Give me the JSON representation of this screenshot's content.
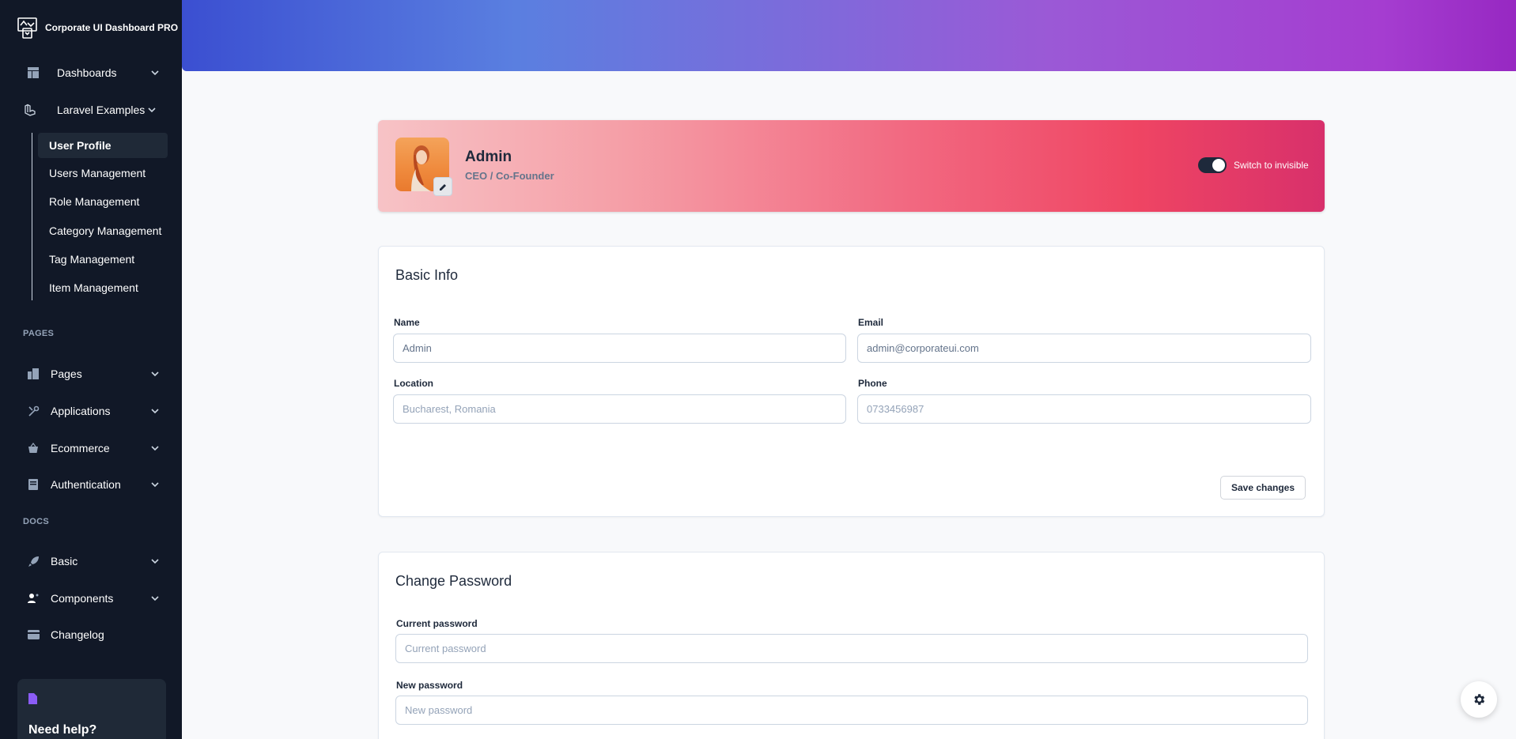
{
  "brand": {
    "title": "Corporate UI Dashboard PRO"
  },
  "sidebar": {
    "top_items": [
      {
        "label": "Dashboards",
        "icon": "dashboard-icon"
      },
      {
        "label": "Laravel Examples",
        "icon": "laravel-icon"
      }
    ],
    "sub_items": [
      {
        "label": "User Profile",
        "active": true
      },
      {
        "label": "Users Management"
      },
      {
        "label": "Role Management"
      },
      {
        "label": "Category Management"
      },
      {
        "label": "Tag Management"
      },
      {
        "label": "Item Management"
      }
    ],
    "pages_section": "PAGES",
    "pages_items": [
      {
        "label": "Pages",
        "icon": "pages-icon"
      },
      {
        "label": "Applications",
        "icon": "tools-icon"
      },
      {
        "label": "Ecommerce",
        "icon": "basket-icon"
      },
      {
        "label": "Authentication",
        "icon": "document-icon"
      }
    ],
    "docs_section": "DOCS",
    "docs_items": [
      {
        "label": "Basic",
        "icon": "rocket-icon"
      },
      {
        "label": "Components",
        "icon": "user-plus-icon"
      },
      {
        "label": "Changelog",
        "icon": "card-icon"
      }
    ],
    "help": {
      "title": "Need help?"
    }
  },
  "profile": {
    "name": "Admin",
    "role": "CEO / Co-Founder",
    "toggle_label": "Switch to invisible",
    "visible_toggle_on": true
  },
  "basic_info": {
    "title": "Basic Info",
    "name_label": "Name",
    "name_value": "Admin",
    "email_label": "Email",
    "email_value": "admin@corporateui.com",
    "location_label": "Location",
    "location_placeholder": "Bucharest, Romania",
    "phone_label": "Phone",
    "phone_placeholder": "0733456987",
    "save_label": "Save changes"
  },
  "change_password": {
    "title": "Change Password",
    "current_label": "Current password",
    "current_placeholder": "Current password",
    "new_label": "New password",
    "new_placeholder": "New password"
  },
  "colors": {
    "sidebar_bg": "#111827",
    "accent": "#1e293b",
    "banner_start": "#3b4fd1",
    "banner_end": "#9728c2"
  }
}
